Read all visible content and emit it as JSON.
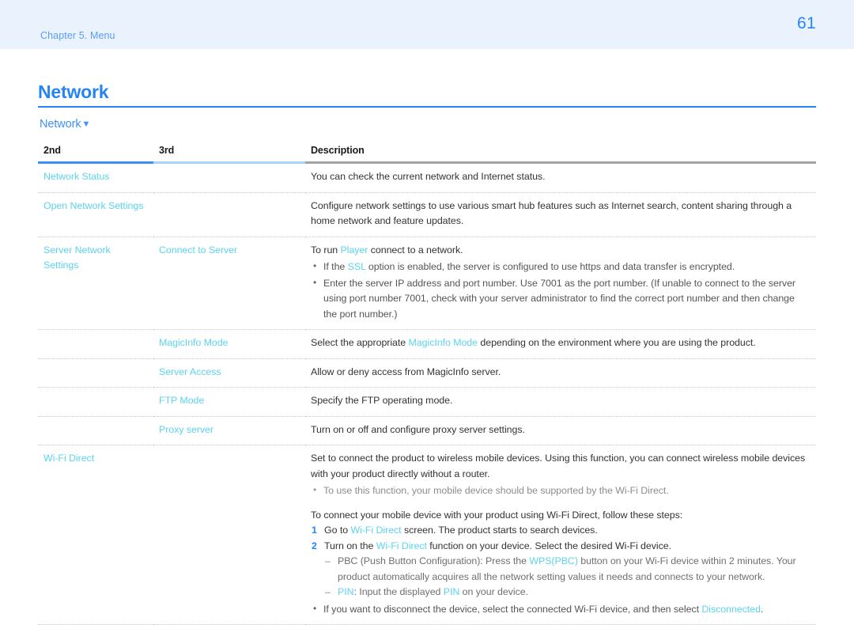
{
  "header": {
    "chapter": "Chapter 5. Menu",
    "page_number": "61",
    "band_color": "#eaf2fd",
    "accent_color": "#2684f5"
  },
  "section": {
    "title": "Network",
    "subsection": "Network",
    "subsection_caret": "▼"
  },
  "table": {
    "headers": {
      "col1": "2nd",
      "col2": "3rd",
      "col3": "Description"
    },
    "header_rule_colors": {
      "col1": "#3d90f7",
      "col2": "#a9d3fb",
      "col3": "#a3a3a3"
    },
    "link_color": "#5cd3ee",
    "rows": [
      {
        "col2nd": "Network Status",
        "col3rd": "",
        "desc_lead": "You can check the current network and Internet status."
      },
      {
        "col2nd": "Open Network Settings",
        "col3rd": "",
        "desc_lead": "Configure network settings to use various smart hub features such as Internet search, content sharing through a home network and feature updates."
      },
      {
        "col2nd": "Server Network Settings",
        "col3rd": "Connect to Server",
        "desc_lead_a": "To run ",
        "desc_lead_link": "Player",
        "desc_lead_b": " connect to a network.",
        "bullet1_a": "If the ",
        "bullet1_link": "SSL",
        "bullet1_b": " option is enabled, the server is configured to use https and data transfer is encrypted.",
        "bullet2": "Enter the server IP address and port number. Use 7001 as the port number. (If unable to connect to the server using port number 7001, check with your server administrator to find the correct port number and then change the port number.)"
      },
      {
        "col2nd": "",
        "col3rd": "MagicInfo Mode",
        "desc_a": "Select the appropriate ",
        "desc_link": "MagicInfo Mode",
        "desc_b": " depending on the environment where you are using the product."
      },
      {
        "col2nd": "",
        "col3rd": "Server Access",
        "desc_lead": "Allow or deny access from MagicInfo server."
      },
      {
        "col2nd": "",
        "col3rd": "FTP Mode",
        "desc_lead": "Specify the FTP operating mode."
      },
      {
        "col2nd": "",
        "col3rd": "Proxy server",
        "desc_lead": "Turn on or off and configure proxy server settings."
      },
      {
        "col2nd": "Wi-Fi Direct",
        "col3rd": "",
        "desc_lead": "Set to connect the product to wireless mobile devices. Using this function, you can connect wireless mobile devices with your product directly without a router.",
        "bullet_muted": "To use this function, your mobile device should be supported by the Wi-Fi Direct.",
        "steps_intro": "To connect your mobile device with your product using Wi-Fi Direct, follow these steps:",
        "step1_num": "1",
        "step1_a": "Go to ",
        "step1_link": "Wi-Fi Direct",
        "step1_b": " screen. The product starts to search devices.",
        "step2_num": "2",
        "step2_a": "Turn on the ",
        "step2_link": "Wi-Fi Direct",
        "step2_b": " function on your device. Select the desired Wi-Fi device.",
        "dash1_a": "PBC (Push Button Configuration): Press the ",
        "dash1_link": "WPS(PBC)",
        "dash1_b": " button on your Wi-Fi device within 2 minutes. Your product automatically acquires all the network setting values it needs and connects to your network.",
        "dash2_link": "PIN",
        "dash2_a": ": Input the displayed ",
        "dash2_link2": "PIN",
        "dash2_b": " on your device.",
        "final_bullet_a": "If you want to disconnect the device, select the connected Wi-Fi device, and then select ",
        "final_bullet_link": "Disconnected",
        "final_bullet_b": "."
      }
    ]
  }
}
